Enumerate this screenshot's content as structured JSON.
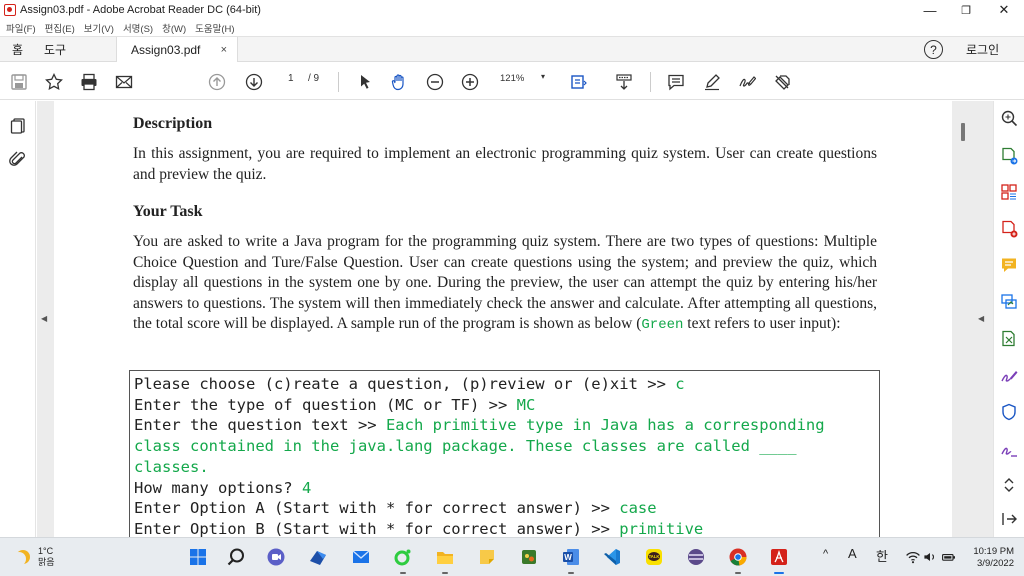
{
  "window": {
    "title": "Assign03.pdf - Adobe Acrobat Reader DC (64-bit)",
    "minimize": "—",
    "restore": "❐",
    "close": "✕"
  },
  "menu": [
    "파일(F)",
    "편집(E)",
    "보기(V)",
    "서명(S)",
    "창(W)",
    "도움말(H)"
  ],
  "tabs": {
    "home": "홈",
    "tools": "도구",
    "document": "Assign03.pdf",
    "close": "×",
    "help": "?",
    "login": "로그인"
  },
  "toolbar": {
    "page_current": "1",
    "page_total": "/ 9",
    "zoom": "121%",
    "zoom_arrow": "▾"
  },
  "document": {
    "heading1": "Description",
    "para1": "In this assignment, you are required to implement an electronic programming quiz system. User can create questions and preview the quiz.",
    "heading2": "Your Task",
    "para2_a": "You are asked to write a Java program for the programming quiz system. There are two types of questions: Multiple Choice Question and Ture/False Question. User can create questions using the system; and preview the quiz, which display all questions in the system one by one. During the preview, the user can attempt the quiz by entering his/her answers to questions. The system will then immediately check the answer and calculate. After attempting all questions, the total score will be displayed. A sample run of the program is shown as below (",
    "para2_green": "Green",
    "para2_b": " text refers to user input):",
    "code": [
      {
        "prompt": "Please choose (c)reate a question, (p)review or (e)xit >> ",
        "input": "c"
      },
      {
        "prompt": "Enter the type of question (MC or TF) >> ",
        "input": "MC"
      },
      {
        "prompt": "Enter the question text >> ",
        "input": "Each primitive type in Java has a corresponding"
      },
      {
        "prompt": "",
        "input": "class contained in the java.lang package. These classes are called ____"
      },
      {
        "prompt": "",
        "input": "classes."
      },
      {
        "prompt": "How many options? ",
        "input": "4"
      },
      {
        "prompt": "Enter Option A (Start with * for correct answer) >> ",
        "input": "case"
      },
      {
        "prompt": "Enter Option B (Start with * for correct answer) >> ",
        "input": "primitive"
      }
    ]
  },
  "taskbar": {
    "temp": "1°C",
    "weather": "맑음",
    "tray_caret": "^",
    "tray_a": "A",
    "tray_ime": "한",
    "time": "10:19 PM",
    "date": "3/9/2022"
  },
  "colors": {
    "acrobat_red": "#d4221a",
    "user_input_green": "#14a84b",
    "taskbar_bg": "#e8ecf0"
  }
}
